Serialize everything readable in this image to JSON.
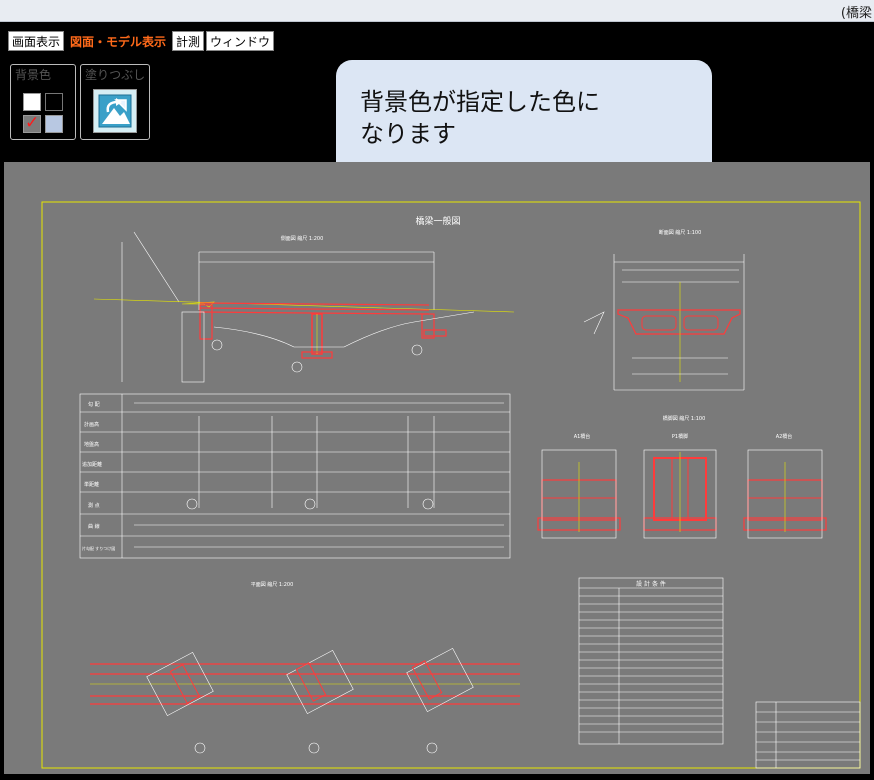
{
  "window": {
    "title": "(橋梁"
  },
  "tabs": [
    {
      "label": "画面表示",
      "active": false
    },
    {
      "label": "図面・モデル表示",
      "active": true
    },
    {
      "label": "計測",
      "active": false
    },
    {
      "label": "ウィンドウ",
      "active": false
    }
  ],
  "ribbon": {
    "background_group": {
      "label": "背景色",
      "swatches": [
        {
          "name": "white",
          "color": "#ffffff",
          "selected": false
        },
        {
          "name": "black",
          "color": "#000000",
          "selected": false
        },
        {
          "name": "gray",
          "color": "#7b7b7b",
          "selected": true
        },
        {
          "name": "light-blue",
          "color": "#b8c8e2",
          "selected": false
        }
      ]
    },
    "fill_group": {
      "label": "塗りつぶし",
      "icon": "fill-icon"
    }
  },
  "callout": {
    "line1": "背景色が指定した色に",
    "line2": "なります"
  },
  "drawing": {
    "background": "#7a7a7a",
    "frame_color": "#e6e600",
    "title": "橋梁一般図",
    "side_view_label": "側面図 縮尺 1:200",
    "section_view_label": "断面図 縮尺 1:100",
    "end_view_label": "橋脚図 縮尺 1:100",
    "plan_view_label": "平面図 縮尺 1:200",
    "design_table_title": "設 計 条 件",
    "profile_rows": [
      "勾 配",
      "計画高",
      "地盤高",
      "追加距離",
      "単距離",
      "測 点",
      "曲 線",
      "片勾配 すりつけ図"
    ],
    "pier_labels": [
      "A1橋台",
      "P1橋脚",
      "A2橋台"
    ]
  }
}
